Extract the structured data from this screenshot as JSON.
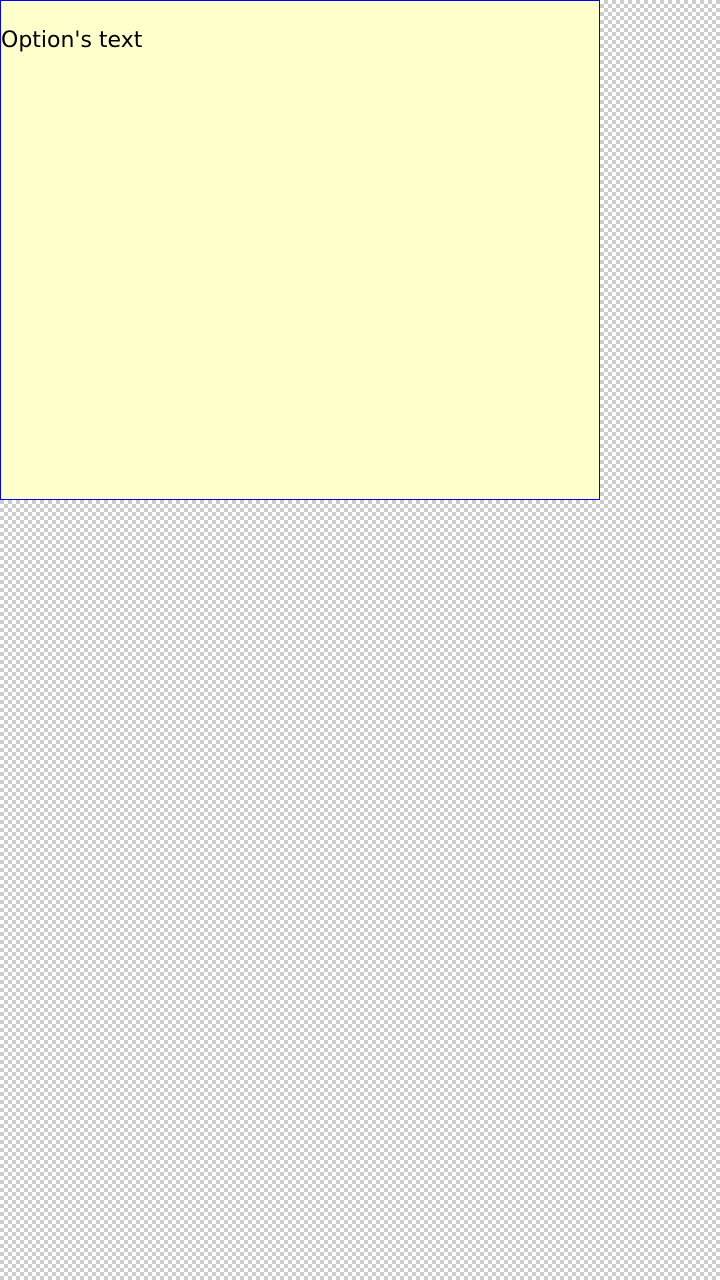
{
  "option": {
    "text": "Option's text"
  },
  "colors": {
    "box_background": "#ffffcc",
    "box_border": "#0000ff",
    "text": "#000000",
    "checker_light": "#ffffff",
    "checker_dark": "#cccccc"
  }
}
